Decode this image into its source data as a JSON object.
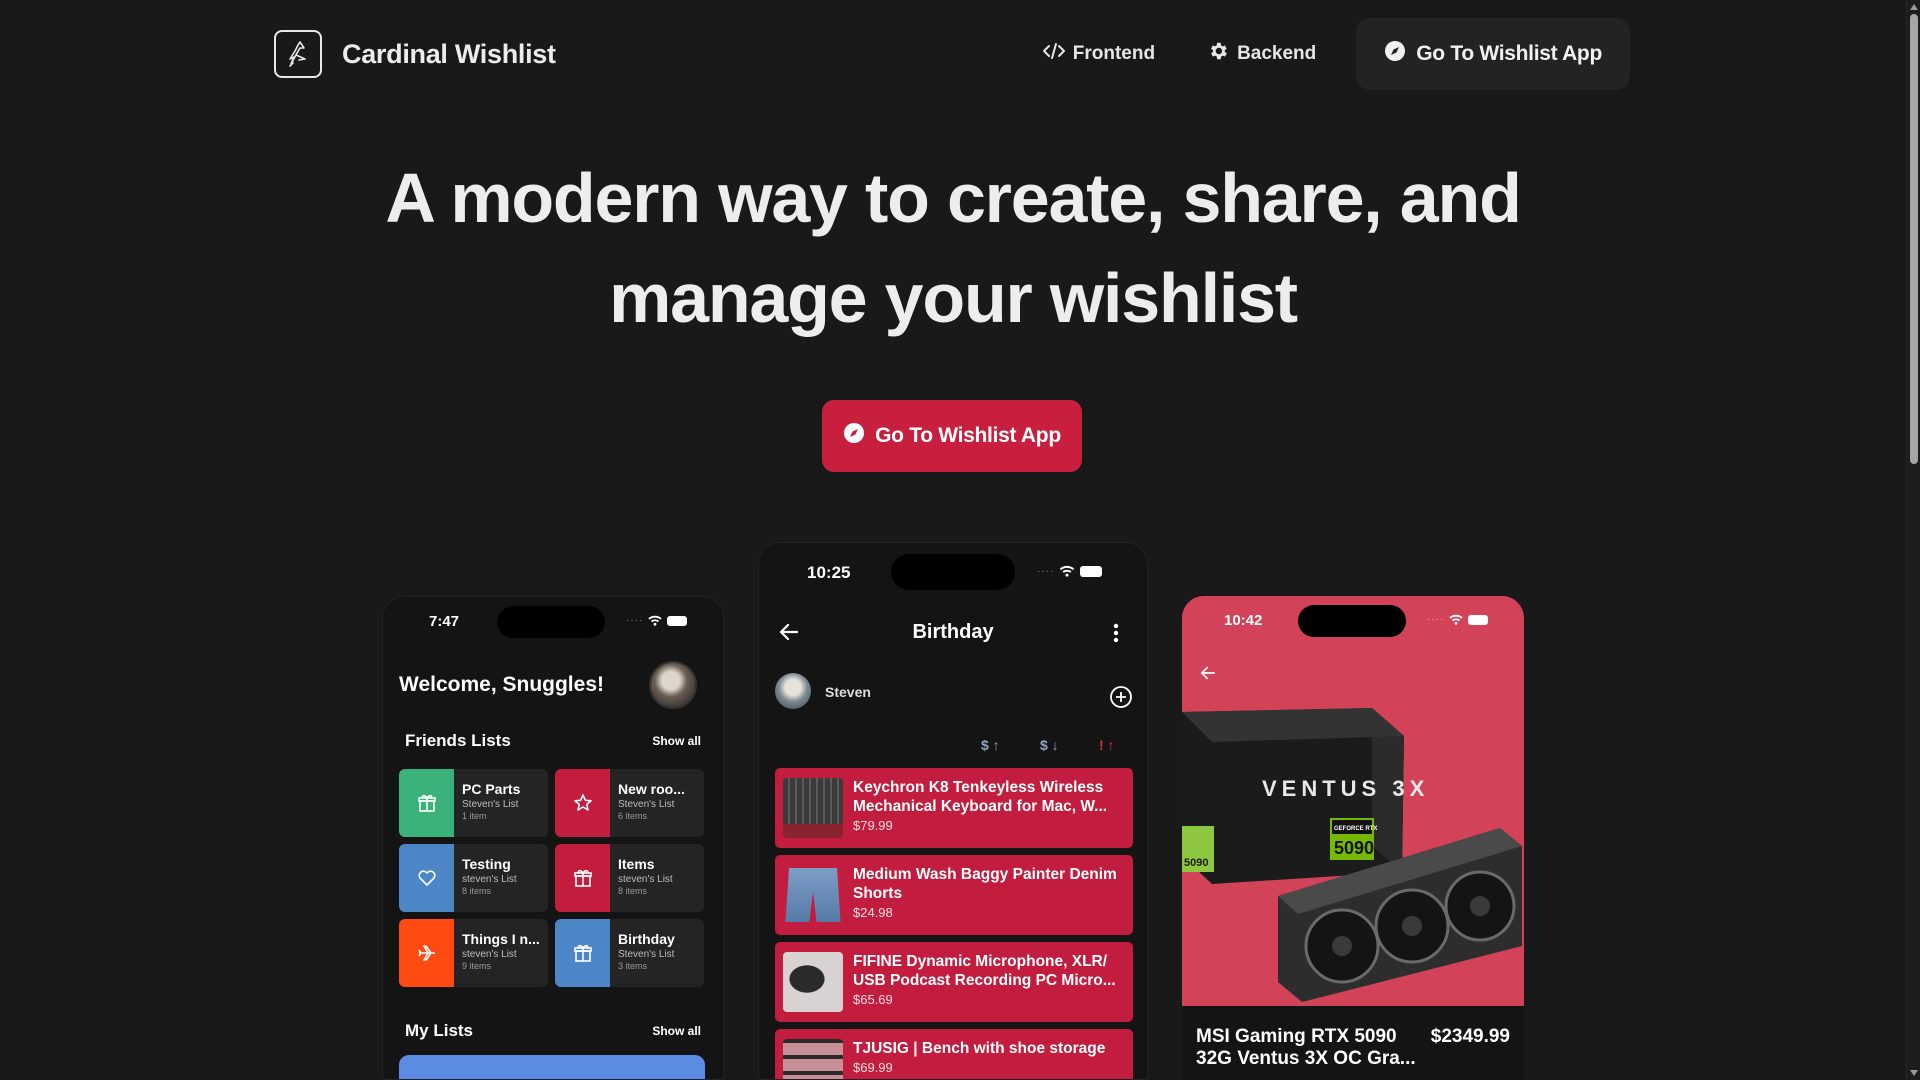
{
  "header": {
    "brand": "Cardinal Wishlist",
    "nav": [
      {
        "label": "Frontend",
        "icon": "code-icon"
      },
      {
        "label": "Backend",
        "icon": "gear-icon"
      }
    ],
    "cta_label": "Go To Wishlist App"
  },
  "hero": {
    "title_line1": "A modern way to create, share, and",
    "title_line2": "manage your wishlist",
    "cta_label": "Go To Wishlist App"
  },
  "colors": {
    "accent": "#c91f3f",
    "background": "#191919",
    "tile_green": "#3bb27a",
    "tile_red": "#c21d3f",
    "tile_blue": "#4d86c6",
    "tile_orange": "#ff4b12",
    "product_bg": "#d2435a"
  },
  "phone_left": {
    "time": "7:47",
    "welcome": "Welcome, Snuggles!",
    "friends_title": "Friends Lists",
    "show_all": "Show all",
    "tiles": [
      {
        "title": "PC Parts",
        "owner": "Steven's List",
        "count": "1 item",
        "icon": "gift-icon"
      },
      {
        "title": "New roo...",
        "owner": "Steven's List",
        "count": "6 items",
        "icon": "star-icon"
      },
      {
        "title": "Testing",
        "owner": "steven's List",
        "count": "8 items",
        "icon": "heart-icon"
      },
      {
        "title": "Items",
        "owner": "steven's List",
        "count": "8 items",
        "icon": "gift-icon"
      },
      {
        "title": "Things I n...",
        "owner": "steven's List",
        "count": "9 items",
        "icon": "plane-icon"
      },
      {
        "title": "Birthday",
        "owner": "Steven's List",
        "count": "3 items",
        "icon": "gift-icon"
      }
    ],
    "my_lists_title": "My Lists",
    "my_lists_show_all": "Show all"
  },
  "phone_mid": {
    "time": "10:25",
    "title": "Birthday",
    "owner": "Steven",
    "sort": [
      "$ ↑",
      "$ ↓",
      "! ↑"
    ],
    "items": [
      {
        "name": "Keychron K8 Tenkeyless Wireless Mechanical Keyboard for Mac, W...",
        "price": "$79.99"
      },
      {
        "name": "Medium Wash Baggy Painter Denim Shorts",
        "price": "$24.98"
      },
      {
        "name": "FIFINE Dynamic Microphone, XLR/ USB Podcast Recording PC Micro...",
        "price": "$65.69"
      },
      {
        "name": "TJUSIG | Bench with shoe storage",
        "price": "$69.99"
      }
    ]
  },
  "phone_right": {
    "time": "10:42",
    "product_name": "MSI Gaming RTX 5090 32G Ventus 3X OC Gra...",
    "product_price": "$2349.99",
    "box_text": "VENTUS 3X",
    "box_badge": "5090",
    "box_series": "GEFORCE RTX"
  }
}
